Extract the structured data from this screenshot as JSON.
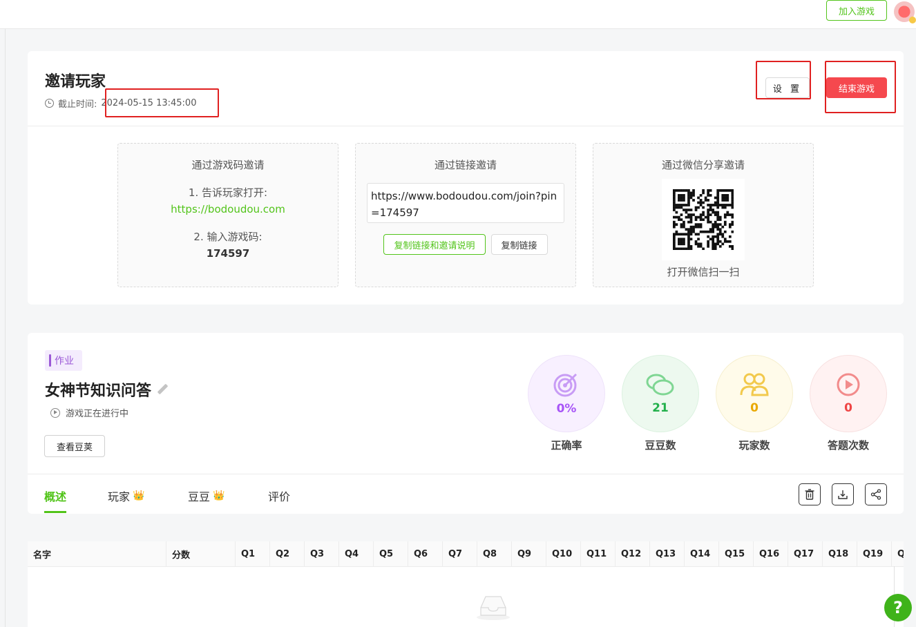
{
  "header": {
    "join_label": "加入游戏"
  },
  "invite": {
    "title": "邀请玩家",
    "deadline_label": "截止时间:",
    "deadline_value": "2024-05-15 13:45:00",
    "settings_label": "设 置",
    "end_label": "结束游戏",
    "by_code": {
      "title": "通过游戏码邀请",
      "step1": "1. 告诉玩家打开:",
      "url": "https://bodoudou.com",
      "step2": "2. 输入游戏码:",
      "pin": "174597"
    },
    "by_link": {
      "title": "通过链接邀请",
      "link": "https://www.bodoudou.com/join?pin=174597",
      "copy_with_desc_label": "复制链接和邀请说明",
      "copy_label": "复制链接"
    },
    "by_wechat": {
      "title": "通过微信分享邀请",
      "caption": "打开微信扫一扫"
    }
  },
  "game": {
    "tag": "作业",
    "title": "女神节知识问答",
    "status": "游戏正在进行中",
    "view_label": "查看豆荚",
    "stats": [
      {
        "value": "0%",
        "label": "正确率",
        "icon": "target-icon",
        "color": "#a855f7"
      },
      {
        "value": "21",
        "label": "豆豆数",
        "icon": "bean-icon",
        "color": "#22b04b"
      },
      {
        "value": "0",
        "label": "玩家数",
        "icon": "users-icon",
        "color": "#e9a800"
      },
      {
        "value": "0",
        "label": "答题次数",
        "icon": "play-icon",
        "color": "#ef4444"
      }
    ],
    "tabs": [
      {
        "label": "概述",
        "active": true
      },
      {
        "label": "玩家",
        "crown": true
      },
      {
        "label": "豆豆",
        "crown": true
      },
      {
        "label": "评价"
      }
    ],
    "actions": [
      "trash-icon",
      "download-icon",
      "share-icon"
    ]
  },
  "table": {
    "columns": [
      "名字",
      "分数",
      "Q1",
      "Q2",
      "Q3",
      "Q4",
      "Q5",
      "Q6",
      "Q7",
      "Q8",
      "Q9",
      "Q10",
      "Q11",
      "Q12",
      "Q13",
      "Q14",
      "Q15",
      "Q16",
      "Q17",
      "Q18",
      "Q19",
      "Q"
    ]
  },
  "help_label": "?"
}
